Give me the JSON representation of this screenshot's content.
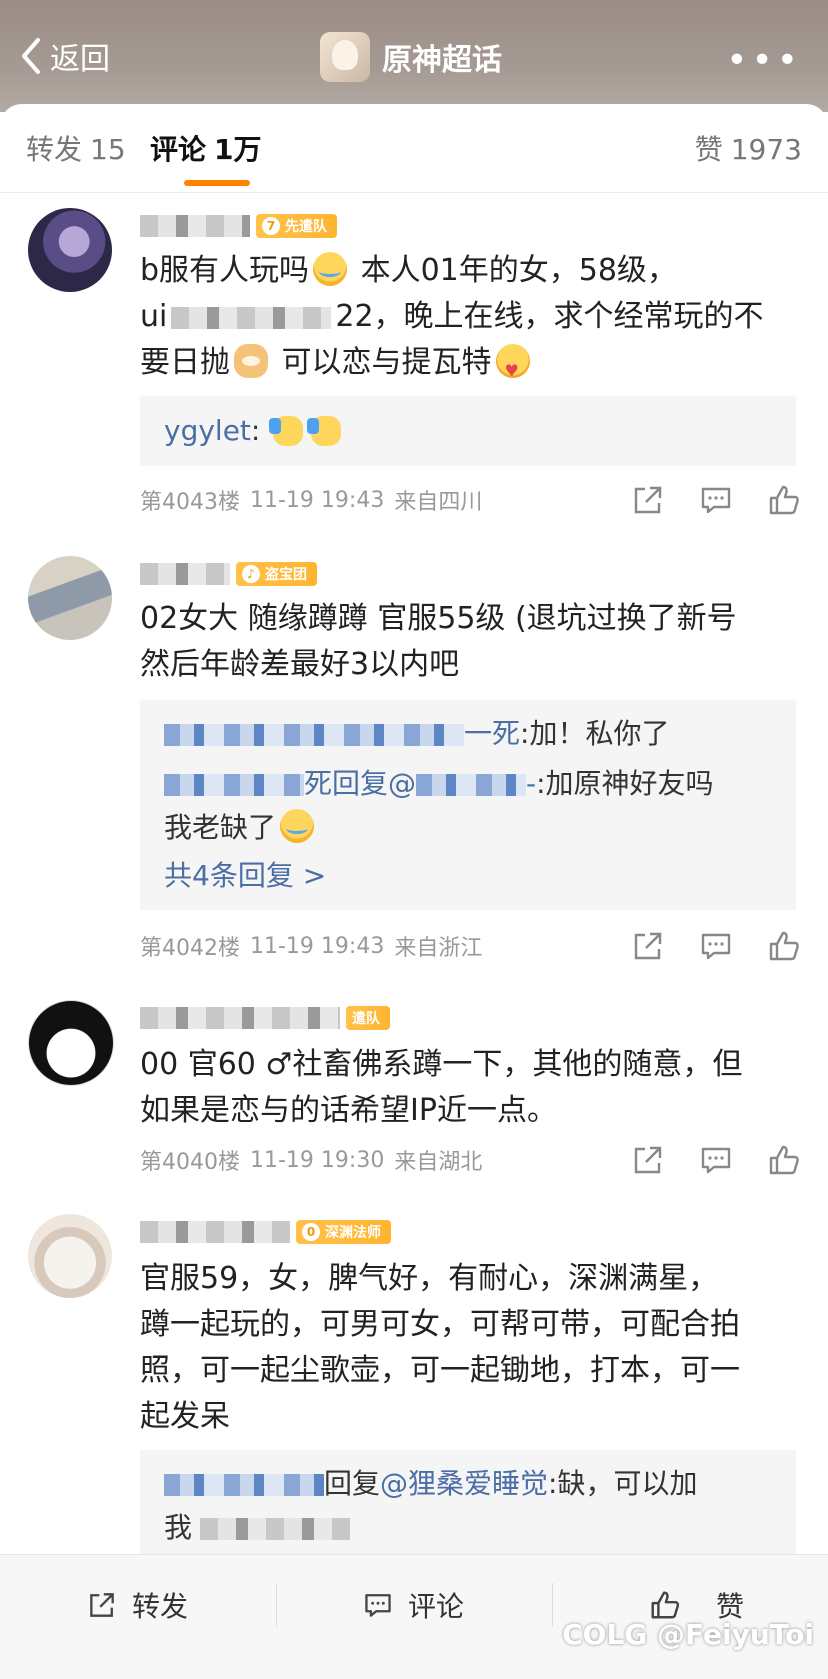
{
  "header": {
    "back_label": "返回",
    "topic_title": "原神超话",
    "more_label": "•••"
  },
  "tabs": {
    "repost_label": "转发",
    "repost_count": "15",
    "comment_label": "评论",
    "comment_count": "1万",
    "like_label": "赞",
    "like_count": "1973"
  },
  "comments": [
    {
      "badge_level": "7",
      "badge_label": "先遣队",
      "text_1": "b服有人玩吗",
      "text_2": " 本人01年的女，58级，",
      "text_3": "ui",
      "text_4": "22，晚上在线，求个经常玩的不",
      "text_5": "要日抛",
      "text_6": " 可以恋与提瓦特",
      "reply_user": "ygylet",
      "reply_sep": ":",
      "floor": "第4043楼",
      "time": "11-19 19:43",
      "location": "来自四川"
    },
    {
      "badge_level": "♪",
      "badge_label": "盗宝团",
      "text_1": "02女大 随缘蹲蹲 官服55级 (退坑过换了新号",
      "text_2": "然后年龄差最好3以内吧",
      "reply1_tail": "一死",
      "reply1_text": ":加！私你了",
      "reply2_mid": "死回复@",
      "reply2_tail": "-",
      "reply2_text": ":加原神好友吗",
      "reply3_text": "我老缺了",
      "more_replies": "共4条回复 >",
      "floor": "第4042楼",
      "time": "11-19 19:43",
      "location": "来自浙江"
    },
    {
      "badge_label": "遣队",
      "text_1": "00 官60 ♂社畜佛系蹲一下，其他的随意，但",
      "text_2": "如果是恋与的话希望IP近一点。",
      "floor": "第4040楼",
      "time": "11-19 19:30",
      "location": "来自湖北"
    },
    {
      "badge_level": "0",
      "badge_label": "深渊法师",
      "text_1": "官服59，女，脾气好，有耐心，深渊满星，",
      "text_2": "蹲一起玩的，可男可女，可帮可带，可配合拍",
      "text_3": "照，可一起尘歌壶，可一起锄地，打本，可一",
      "text_4": "起发呆",
      "reply1_mid": "回复",
      "reply1_user": "@狸桑爱睡觉",
      "reply1_text": ":缺，可以加",
      "reply2_text": "我"
    }
  ],
  "bottom_bar": {
    "repost_label": "转发",
    "comment_label": "评论",
    "like_label": "赞"
  },
  "watermark": "COLG @FeiyuToi"
}
